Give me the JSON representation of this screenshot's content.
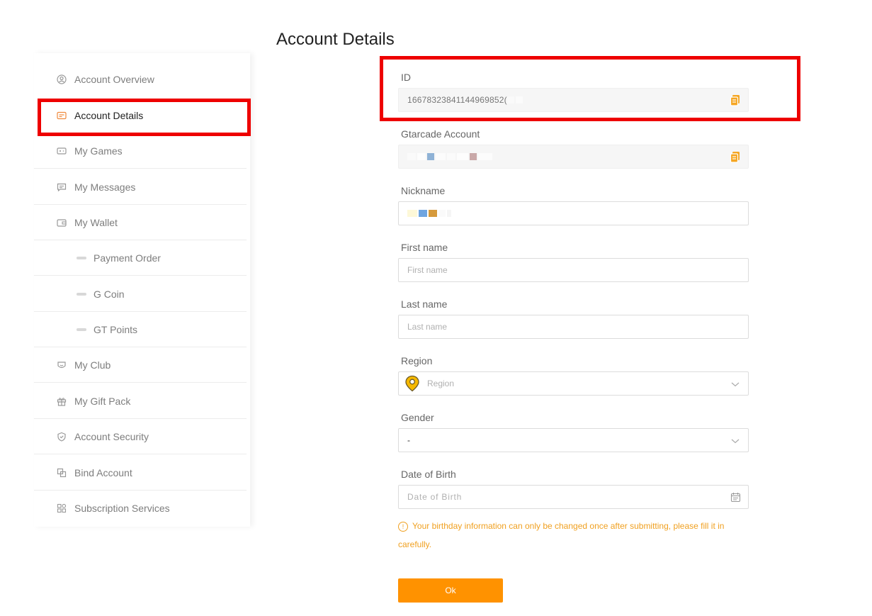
{
  "page": {
    "title": "Account Details"
  },
  "sidebar": {
    "items": [
      {
        "label": "Account Overview",
        "icon": "user-circle-icon"
      },
      {
        "label": "Account Details",
        "icon": "id-card-icon",
        "active": true
      },
      {
        "label": "My Games",
        "icon": "gamepad-icon"
      },
      {
        "label": "My Messages",
        "icon": "message-icon"
      },
      {
        "label": "My Wallet",
        "icon": "wallet-icon"
      },
      {
        "label": "Payment Order",
        "sub": true
      },
      {
        "label": "G Coin",
        "sub": true
      },
      {
        "label": "GT Points",
        "sub": true
      },
      {
        "label": "My Club",
        "icon": "club-icon"
      },
      {
        "label": "My Gift Pack",
        "icon": "gift-icon"
      },
      {
        "label": "Account Security",
        "icon": "shield-icon"
      },
      {
        "label": "Bind Account",
        "icon": "link-icon"
      },
      {
        "label": "Subscription Services",
        "icon": "grid-icon"
      }
    ]
  },
  "form": {
    "id": {
      "label": "ID",
      "value": "16678323841144969852("
    },
    "gtarcade_account": {
      "label": "Gtarcade Account"
    },
    "nickname": {
      "label": "Nickname"
    },
    "first_name": {
      "label": "First name",
      "placeholder": "First name"
    },
    "last_name": {
      "label": "Last name",
      "placeholder": "Last name"
    },
    "region": {
      "label": "Region",
      "placeholder": "Region"
    },
    "gender": {
      "label": "Gender",
      "value": "-"
    },
    "dob": {
      "label": "Date of Birth",
      "placeholder": "Date of Birth"
    },
    "notice": "Your birthday information can only be changed once after submitting, please fill it in carefully.",
    "submit_label": "Ok"
  },
  "colors": {
    "accent": "#ff9200",
    "highlight": "#ee0000",
    "warning": "#f0a020"
  }
}
